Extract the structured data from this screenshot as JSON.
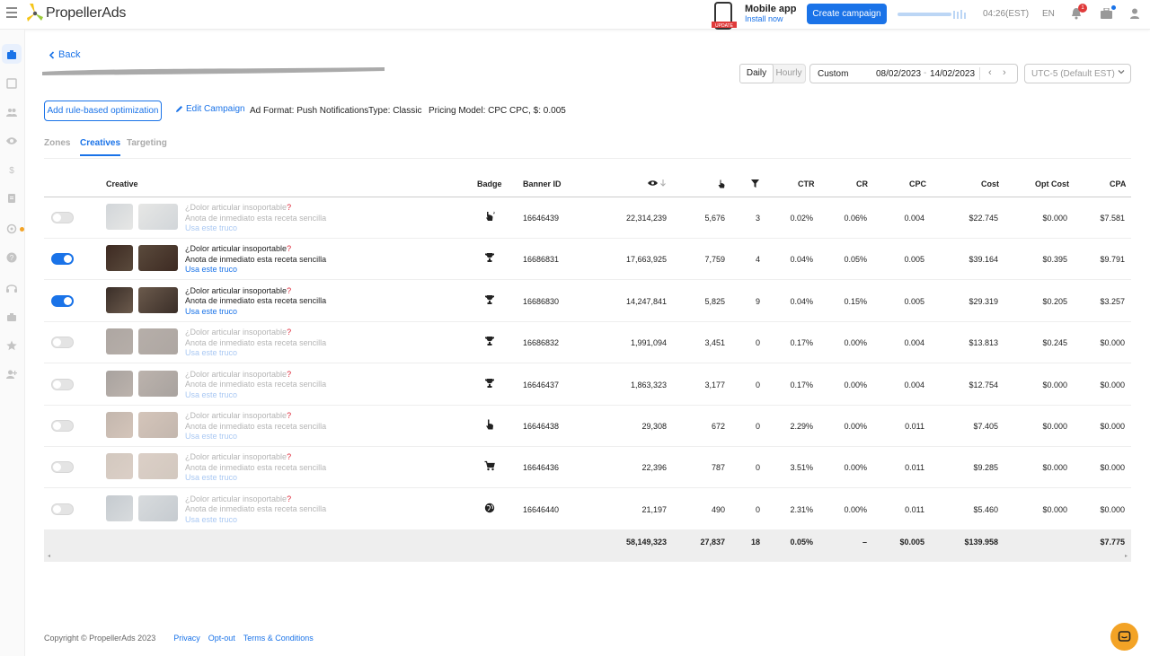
{
  "brand": {
    "name": "PropellerAds"
  },
  "topbar": {
    "mobile_title": "Mobile app",
    "mobile_link": "Install now",
    "phone_label": "UPDATE",
    "create_label": "Create campaign",
    "time": "04:26(EST)",
    "lang": "EN",
    "notif_count": "1"
  },
  "header": {
    "back": "Back",
    "granularity": [
      "Daily",
      "Hourly"
    ],
    "date_label": "Custom",
    "date_from": "08/02/2023",
    "date_sep": "-",
    "date_to": "14/02/2023",
    "timezone": "UTC-5 (Default EST)",
    "rule_button": "Add rule-based optimization",
    "edit": "Edit Campaign",
    "ad_format": "Ad Format: Push Notifications",
    "type": "Type: Classic",
    "pricing": "Pricing Model: CPC",
    "cpc": "CPC, $: 0.005"
  },
  "tabs": [
    "Zones",
    "Creatives",
    "Targeting"
  ],
  "columns": {
    "creative": "Creative",
    "badge": "Badge",
    "banner_id": "Banner ID",
    "ctr": "CTR",
    "cr": "CR",
    "cpc": "CPC",
    "cost": "Cost",
    "opt_cost": "Opt Cost",
    "cpa": "CPA"
  },
  "creative_text": {
    "line1": "¿Dolor articular insoportable",
    "line1_mark": "?",
    "line2": "Anota de inmediato esta receta sencilla",
    "line3": "Usa este truco"
  },
  "rows": [
    {
      "on": false,
      "badge_icon": "fire-hand-icon",
      "banner_id": "16646439",
      "impressions": "22,314,239",
      "clicks": "5,676",
      "conversions": "3",
      "ctr": "0.02%",
      "cr": "0.06%",
      "cpc": "0.004",
      "cost": "$22.745",
      "opt_cost": "$0.000",
      "cpa": "$7.581"
    },
    {
      "on": true,
      "badge_icon": "trophy-icon",
      "banner_id": "16686831",
      "impressions": "17,663,925",
      "clicks": "7,759",
      "conversions": "4",
      "ctr": "0.04%",
      "cr": "0.05%",
      "cpc": "0.005",
      "cost": "$39.164",
      "opt_cost": "$0.395",
      "cpa": "$9.791"
    },
    {
      "on": true,
      "badge_icon": "trophy-icon",
      "banner_id": "16686830",
      "impressions": "14,247,841",
      "clicks": "5,825",
      "conversions": "9",
      "ctr": "0.04%",
      "cr": "0.15%",
      "cpc": "0.005",
      "cost": "$29.319",
      "opt_cost": "$0.205",
      "cpa": "$3.257"
    },
    {
      "on": false,
      "badge_icon": "trophy-icon",
      "banner_id": "16686832",
      "impressions": "1,991,094",
      "clicks": "3,451",
      "conversions": "0",
      "ctr": "0.17%",
      "cr": "0.00%",
      "cpc": "0.004",
      "cost": "$13.813",
      "opt_cost": "$0.245",
      "cpa": "$0.000"
    },
    {
      "on": false,
      "badge_icon": "trophy-icon",
      "banner_id": "16646437",
      "impressions": "1,863,323",
      "clicks": "3,177",
      "conversions": "0",
      "ctr": "0.17%",
      "cr": "0.00%",
      "cpc": "0.004",
      "cost": "$12.754",
      "opt_cost": "$0.000",
      "cpa": "$0.000"
    },
    {
      "on": false,
      "badge_icon": "pointer-hand-icon",
      "banner_id": "16646438",
      "impressions": "29,308",
      "clicks": "672",
      "conversions": "0",
      "ctr": "2.29%",
      "cr": "0.00%",
      "cpc": "0.011",
      "cost": "$7.405",
      "opt_cost": "$0.000",
      "cpa": "$0.000"
    },
    {
      "on": false,
      "badge_icon": "cart-icon",
      "banner_id": "16646436",
      "impressions": "22,396",
      "clicks": "787",
      "conversions": "0",
      "ctr": "3.51%",
      "cr": "0.00%",
      "cpc": "0.011",
      "cost": "$9.285",
      "opt_cost": "$0.000",
      "cpa": "$0.000"
    },
    {
      "on": false,
      "badge_icon": "globe-icon",
      "banner_id": "16646440",
      "impressions": "21,197",
      "clicks": "490",
      "conversions": "0",
      "ctr": "2.31%",
      "cr": "0.00%",
      "cpc": "0.011",
      "cost": "$5.460",
      "opt_cost": "$0.000",
      "cpa": "$0.000"
    }
  ],
  "totals": {
    "impressions": "58,149,323",
    "clicks": "27,837",
    "conversions": "18",
    "ctr": "0.05%",
    "cr": "–",
    "cpc": "$0.005",
    "cost": "$139.958",
    "cpa": "$7.775"
  },
  "footer": {
    "copyright": "Copyright © PropellerAds 2023",
    "privacy": "Privacy",
    "optout": "Opt-out",
    "terms": "Terms & Conditions"
  },
  "colors": {
    "accent": "#1a73e8",
    "chat": "#f3a326"
  }
}
